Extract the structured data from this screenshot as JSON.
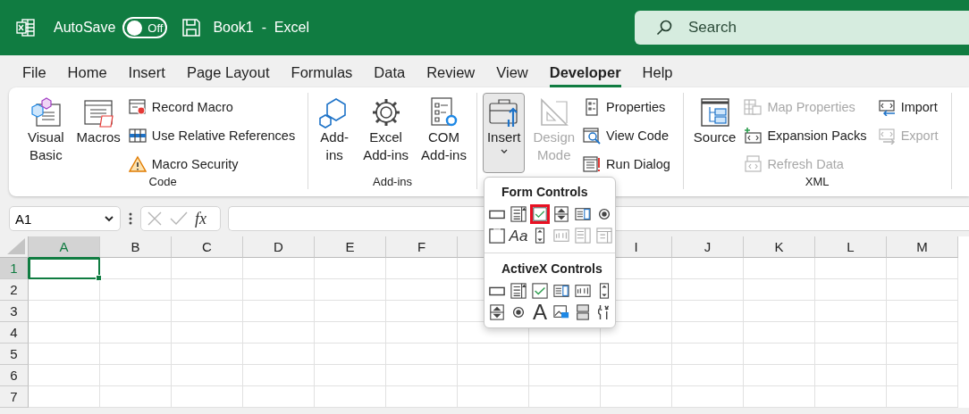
{
  "title_bar": {
    "autosave_label": "AutoSave",
    "autosave": {
      "on": false,
      "label": "Off"
    },
    "title": "Book1  -  Excel",
    "search": {
      "placeholder": "Search"
    }
  },
  "tabs": [
    {
      "label": "File",
      "selected": false
    },
    {
      "label": "Home",
      "selected": false
    },
    {
      "label": "Insert",
      "selected": false
    },
    {
      "label": "Page Layout",
      "selected": false
    },
    {
      "label": "Formulas",
      "selected": false
    },
    {
      "label": "Data",
      "selected": false
    },
    {
      "label": "Review",
      "selected": false
    },
    {
      "label": "View",
      "selected": false
    },
    {
      "label": "Developer",
      "selected": true
    },
    {
      "label": "Help",
      "selected": false
    }
  ],
  "ribbon": {
    "groups": [
      {
        "label": "Code",
        "large": [
          {
            "kind": "vba",
            "label": "Visual\nBasic",
            "disabled": false,
            "selected": false
          },
          {
            "kind": "macros",
            "label": "Macros",
            "disabled": false,
            "selected": false
          }
        ],
        "small": [
          [
            {
              "kind": "record",
              "label": "Record Macro",
              "disabled": false
            },
            {
              "kind": "relative",
              "label": "Use Relative References",
              "disabled": false
            },
            {
              "kind": "warning",
              "label": "Macro Security",
              "disabled": false
            }
          ]
        ]
      },
      {
        "label": "Add-ins",
        "large": [
          {
            "kind": "addins",
            "label": "Add-\nins",
            "disabled": false,
            "selected": false
          },
          {
            "kind": "gear",
            "label": "Excel\nAdd-ins",
            "disabled": false,
            "selected": false
          },
          {
            "kind": "com",
            "label": "COM\nAdd-ins",
            "disabled": false,
            "selected": false
          }
        ]
      },
      {
        "large": [
          {
            "kind": "toolbox",
            "label": "Insert",
            "disabled": false,
            "selected": true,
            "caret": true
          },
          {
            "kind": "ruler",
            "label": "Design\nMode",
            "disabled": true,
            "selected": false
          }
        ],
        "small": [
          [
            {
              "kind": "properties",
              "label": "Properties",
              "disabled": false
            },
            {
              "kind": "viewcode",
              "label": "View Code",
              "disabled": false
            },
            {
              "kind": "rundialog",
              "label": "Run Dialog",
              "disabled": false
            }
          ]
        ]
      },
      {
        "label": "XML",
        "large": [
          {
            "kind": "source",
            "label": "Source",
            "disabled": false,
            "selected": false
          }
        ],
        "small": [
          [
            {
              "kind": "map",
              "label": "Map Properties",
              "disabled": true
            },
            {
              "kind": "expansion",
              "label": "Expansion Packs",
              "disabled": false
            },
            {
              "kind": "refresh",
              "label": "Refresh Data",
              "disabled": true
            }
          ],
          [
            {
              "kind": "import",
              "label": "Import",
              "disabled": false
            },
            {
              "kind": "export",
              "label": "Export",
              "disabled": true
            }
          ]
        ]
      }
    ]
  },
  "formula_bar": {
    "name_box": "A1",
    "function_label": "fx"
  },
  "sheet": {
    "columns_left": [
      {
        "label": "A",
        "selected": true
      },
      {
        "label": "B",
        "selected": false
      },
      {
        "label": "C",
        "selected": false
      },
      {
        "label": "D",
        "selected": false
      },
      {
        "label": "E",
        "selected": false
      },
      {
        "label": "F",
        "selected": false
      }
    ],
    "columns_right": [
      {
        "label": "I",
        "selected": false
      },
      {
        "label": "J",
        "selected": false
      },
      {
        "label": "K",
        "selected": false
      },
      {
        "label": "L",
        "selected": false
      },
      {
        "label": "M",
        "selected": false
      }
    ],
    "rows": [
      {
        "label": "1",
        "selected": true
      },
      {
        "label": "2",
        "selected": false
      },
      {
        "label": "3",
        "selected": false
      },
      {
        "label": "4",
        "selected": false
      },
      {
        "label": "5",
        "selected": false
      },
      {
        "label": "6",
        "selected": false
      },
      {
        "label": "7",
        "selected": false
      }
    ]
  },
  "insert_menu": {
    "sections": [
      {
        "title": "Form Controls",
        "items": [
          {
            "kind": "button",
            "selected": false,
            "disabled": false
          },
          {
            "kind": "combo",
            "selected": false,
            "disabled": false
          },
          {
            "kind": "checkbox",
            "selected": true,
            "disabled": false
          },
          {
            "kind": "spin",
            "selected": false,
            "disabled": false
          },
          {
            "kind": "listbox",
            "selected": false,
            "disabled": false
          },
          {
            "kind": "option",
            "selected": false,
            "disabled": false
          },
          {
            "kind": "groupbox",
            "selected": false,
            "disabled": false
          },
          {
            "kind": "label",
            "glyph": "Aa",
            "selected": false,
            "disabled": false
          },
          {
            "kind": "scrollbar",
            "selected": false,
            "disabled": false
          },
          {
            "kind": "textfield",
            "selected": false,
            "disabled": true
          },
          {
            "kind": "listedit",
            "selected": false,
            "disabled": true
          },
          {
            "kind": "dropdown",
            "selected": false,
            "disabled": true
          }
        ]
      },
      {
        "title": "ActiveX Controls",
        "items": [
          {
            "kind": "button",
            "selected": false,
            "disabled": false
          },
          {
            "kind": "combo",
            "selected": false,
            "disabled": false
          },
          {
            "kind": "checkbox",
            "selected": false,
            "disabled": false
          },
          {
            "kind": "listbox",
            "selected": false,
            "disabled": false
          },
          {
            "kind": "textfield",
            "selected": false,
            "disabled": false
          },
          {
            "kind": "scrollbar",
            "selected": false,
            "disabled": false
          },
          {
            "kind": "spin",
            "selected": false,
            "disabled": false
          },
          {
            "kind": "option",
            "selected": false,
            "disabled": false
          },
          {
            "kind": "biglabel",
            "glyph": "A",
            "selected": false,
            "disabled": false
          },
          {
            "kind": "image",
            "selected": false,
            "disabled": false
          },
          {
            "kind": "toggle",
            "selected": false,
            "disabled": false
          },
          {
            "kind": "more",
            "selected": false,
            "disabled": false
          }
        ]
      }
    ]
  }
}
